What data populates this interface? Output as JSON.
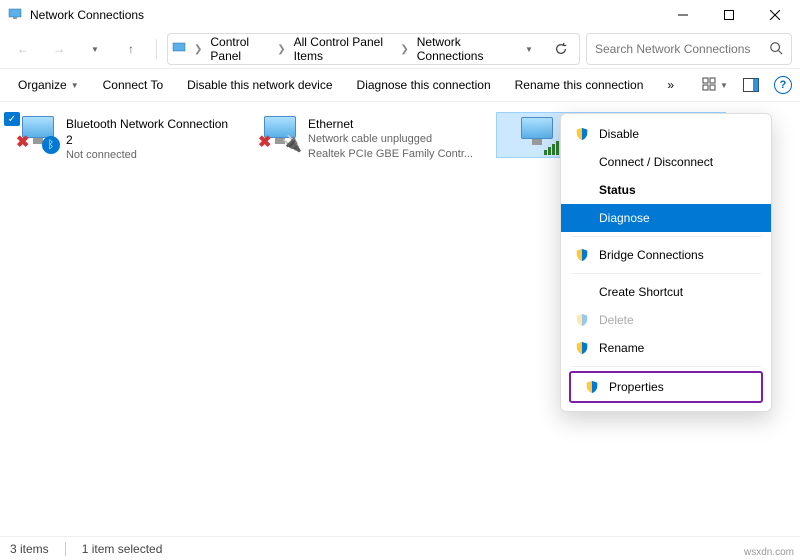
{
  "title": "Network Connections",
  "breadcrumbs": [
    "Control Panel",
    "All Control Panel Items",
    "Network Connections"
  ],
  "search_placeholder": "Search Network Connections",
  "toolbar": {
    "organize": "Organize",
    "connect_to": "Connect To",
    "disable": "Disable this network device",
    "diagnose": "Diagnose this connection",
    "rename": "Rename this connection",
    "overflow": "»"
  },
  "items": [
    {
      "name": "Bluetooth Network Connection 2",
      "line2": "Not connected",
      "line3": ""
    },
    {
      "name": "Ethernet",
      "line2": "Network cable unplugged",
      "line3": "Realtek PCIe GBE Family Contr..."
    },
    {
      "name": "Wi-Fi",
      "line2": "",
      "line3": ""
    }
  ],
  "context_menu": {
    "disable": "Disable",
    "connect": "Connect / Disconnect",
    "status": "Status",
    "diagnose": "Diagnose",
    "bridge": "Bridge Connections",
    "shortcut": "Create Shortcut",
    "delete": "Delete",
    "rename": "Rename",
    "properties": "Properties"
  },
  "status": {
    "count": "3 items",
    "selected": "1 item selected"
  },
  "watermark": "wsxdn.com"
}
